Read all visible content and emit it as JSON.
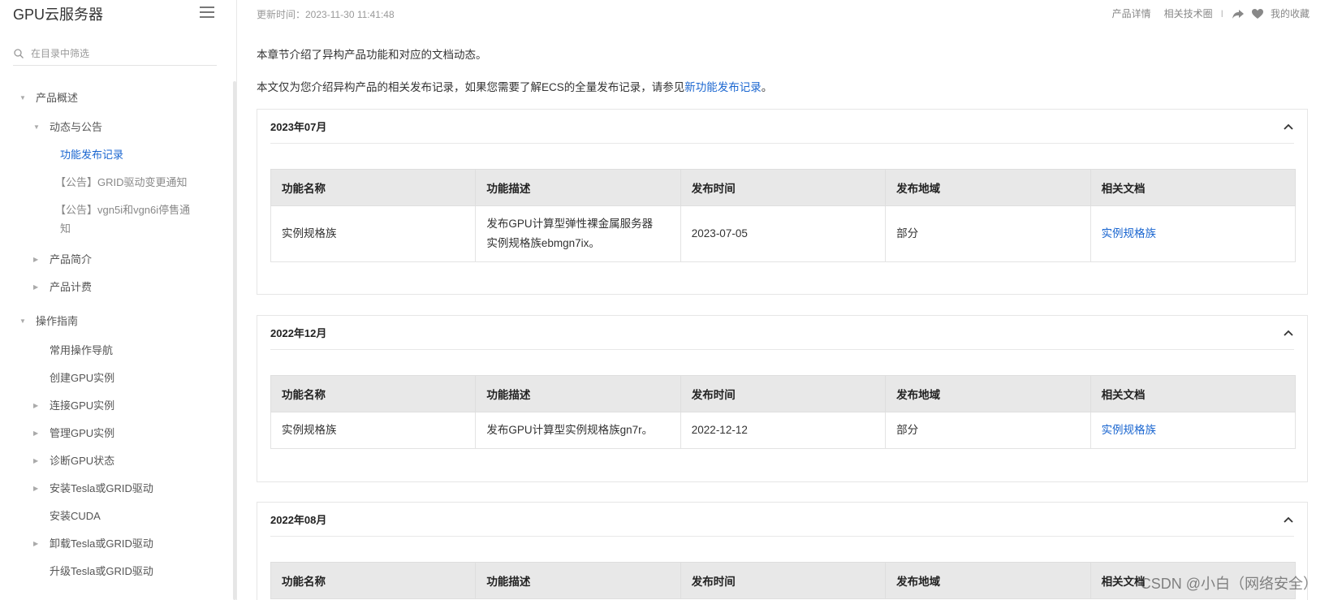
{
  "sidebar": {
    "title": "GPU云服务器",
    "search_placeholder": "在目录中筛选",
    "items": [
      {
        "label": "产品概述"
      },
      {
        "label": "动态与公告"
      },
      {
        "label": "功能发布记录"
      },
      {
        "label": "【公告】GRID驱动变更通知"
      },
      {
        "label": "【公告】vgn5i和vgn6i停售通"
      },
      {
        "label": "知"
      },
      {
        "label": "产品简介"
      },
      {
        "label": "产品计费"
      },
      {
        "label": "操作指南"
      },
      {
        "label": "常用操作导航"
      },
      {
        "label": "创建GPU实例"
      },
      {
        "label": "连接GPU实例"
      },
      {
        "label": "管理GPU实例"
      },
      {
        "label": "诊断GPU状态"
      },
      {
        "label": "安装Tesla或GRID驱动"
      },
      {
        "label": "安装CUDA"
      },
      {
        "label": "卸载Tesla或GRID驱动"
      },
      {
        "label": "升级Tesla或GRID驱动"
      }
    ]
  },
  "topbar": {
    "updated": "更新时间：2023-11-30 11:41:48",
    "product_detail": "产品详情",
    "tech_circle": "相关技术圈",
    "divider": "I",
    "favorite": "我的收藏"
  },
  "intro": {
    "line1": "本章节介绍了异构产品功能和对应的文档动态。",
    "line2_prefix": "本文仅为您介绍异构产品的相关发布记录，如果您需要了解ECS的全量发布记录，请参见",
    "line2_link": "新功能发布记录",
    "line2_suffix": "。"
  },
  "table_headers": [
    "功能名称",
    "功能描述",
    "发布时间",
    "发布地域",
    "相关文档"
  ],
  "sections": [
    {
      "title": "2023年07月",
      "rows": [
        {
          "name": "实例规格族",
          "desc_line1": "发布GPU计算型弹性裸金属服务器",
          "desc_line2": "实例规格族ebmgn7ix。",
          "date": "2023-07-05",
          "region": "部分",
          "doc": "实例规格族"
        }
      ]
    },
    {
      "title": "2022年12月",
      "rows": [
        {
          "name": "实例规格族",
          "desc_line1": "发布GPU计算型实例规格族gn7r。",
          "desc_line2": "",
          "date": "2022-12-12",
          "region": "部分",
          "doc": "实例规格族"
        }
      ]
    },
    {
      "title": "2022年08月",
      "rows": []
    }
  ],
  "watermark": "CSDN @小白（网络安全）"
}
